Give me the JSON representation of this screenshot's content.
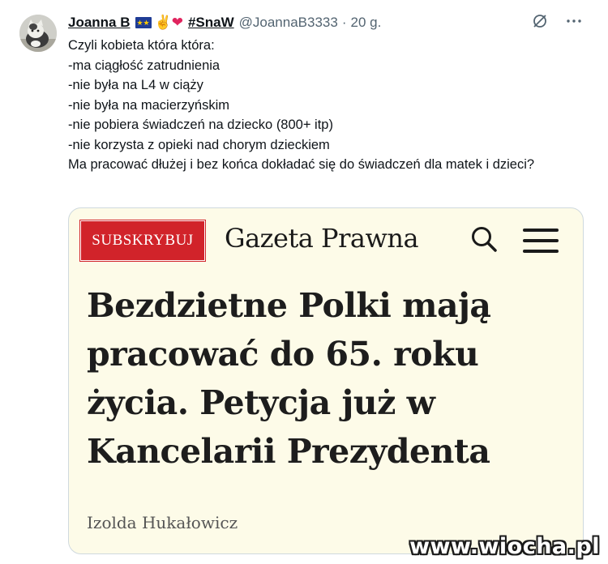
{
  "tweet": {
    "display_name": "Joanna B",
    "name_emoji": "✌❤",
    "tag": "#SnaW",
    "handle": "@JoannaB3333",
    "separator": "·",
    "time": "20 g.",
    "lines": [
      "Czyli kobieta która która:",
      "-ma ciągłość zatrudnienia",
      "-nie była na L4 w ciąży",
      "-nie była na macierzyńskim",
      "-nie pobiera świadczeń na dziecko (800+ itp)",
      "-nie korzysta z opieki nad chorym dzieckiem",
      "Ma pracować dłużej i bez końca dokładać się do świadczeń dla matek i dzieci?"
    ]
  },
  "card": {
    "subscribe_label": "SUBSKRYBUJ",
    "brand": "Gazeta Prawna",
    "headline_lines": [
      "Bezdzietne Polki mają",
      "pracować do 65. roku",
      "życia. Petycja już w",
      "Kancelarii Prezydenta"
    ],
    "author": "Izolda Hukałowicz",
    "accent_color": "#d1232a",
    "background_color": "#fdfbe8"
  },
  "icons": {
    "grok": "grok-icon",
    "more": "more-icon",
    "search": "search-icon",
    "menu": "menu-icon",
    "eu_flag": "eu-flag-icon"
  },
  "watermark": "www.wiocha.pl"
}
